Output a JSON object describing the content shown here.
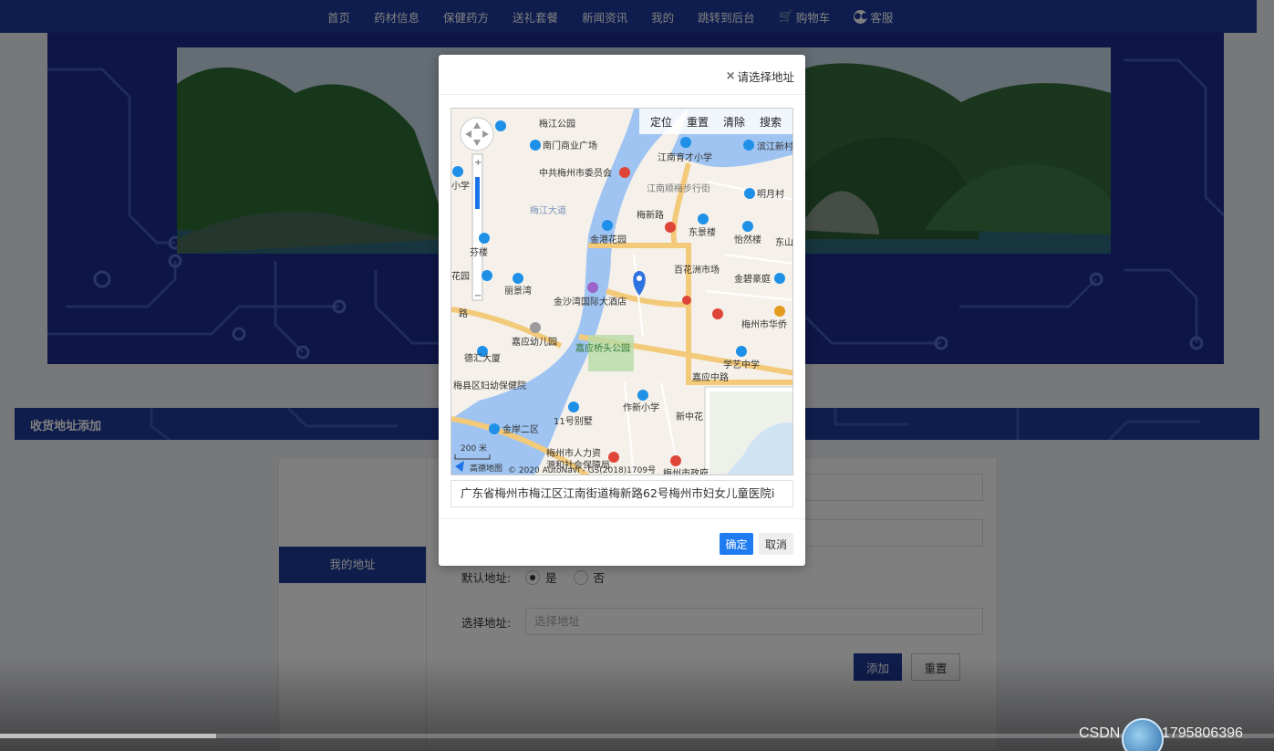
{
  "nav": {
    "items": [
      {
        "label": "首页",
        "icon": ""
      },
      {
        "label": "药材信息",
        "icon": ""
      },
      {
        "label": "保健药方",
        "icon": ""
      },
      {
        "label": "送礼套餐",
        "icon": ""
      },
      {
        "label": "新闻资讯",
        "icon": ""
      },
      {
        "label": "我的",
        "icon": ""
      },
      {
        "label": "跳转到后台",
        "icon": ""
      },
      {
        "label": "购物车",
        "icon": "cart-icon"
      },
      {
        "label": "客服",
        "icon": "chat-icon"
      }
    ]
  },
  "section": {
    "title": "收货地址添加"
  },
  "sidebar": {
    "items": [
      {
        "label": "我的地址"
      }
    ]
  },
  "form": {
    "default_label": "默认地址:",
    "default_options": [
      {
        "label": "是",
        "checked": true
      },
      {
        "label": "否",
        "checked": false
      }
    ],
    "address_label": "选择地址:",
    "address_placeholder": "选择地址",
    "add_button": "添加",
    "reset_button": "重置"
  },
  "modal": {
    "title": "请选择地址",
    "close_glyph": "×",
    "toolbar": [
      "定位",
      "重置",
      "清除",
      "搜索"
    ],
    "address_value": "广东省梅州市梅江区江南街道梅新路62号梅州市妇女儿童医院i",
    "ok_button": "确定",
    "cancel_button": "取消"
  },
  "map": {
    "labels": {
      "l1": "梅江公园",
      "l2": "南门商业广场",
      "l3": "江南育才小学",
      "l4": "滨江新村",
      "l5": "中共梅州市委员会",
      "l6": "江南顺梅步行街",
      "l7": "明月村",
      "l8": "金港花园",
      "l9": "东景楼",
      "l10": "怡然楼",
      "l11": "东山",
      "l12": "百花洲市场",
      "l13": "金碧豪庭",
      "l14": "丽景湾",
      "l15": "金沙湾国际大酒店",
      "l16": "梅州市华侨",
      "l17": "嘉应幼儿园",
      "l18": "嘉应桥头公园",
      "l19": "学艺中学",
      "l20": "德汇大厦",
      "l21": "嘉应中路",
      "l22": "梅县区妇幼保健院",
      "l23": "作新小学",
      "l24": "新中花",
      "l25": "11号别墅",
      "l26": "金岸二区",
      "l27": "梅州市人力资",
      "l28": "源和社会保障局",
      "l29": "梅州市政府",
      "l30": "梅新路",
      "l31": "芬楼",
      "l32": "花园",
      "l33": "小学",
      "l34": "路",
      "l35": "梅江大道"
    },
    "scale": "200 米",
    "copyright": "© 2020 AutoNavi - GS(2018)1709号",
    "brand": "高德地图"
  },
  "watermark": "CSDN @QQ1795806396",
  "video_progress": 0.17,
  "colors": {
    "nav": "#1d3a9c",
    "primary": "#1e7bf0",
    "accent": "#1f3a9a"
  }
}
